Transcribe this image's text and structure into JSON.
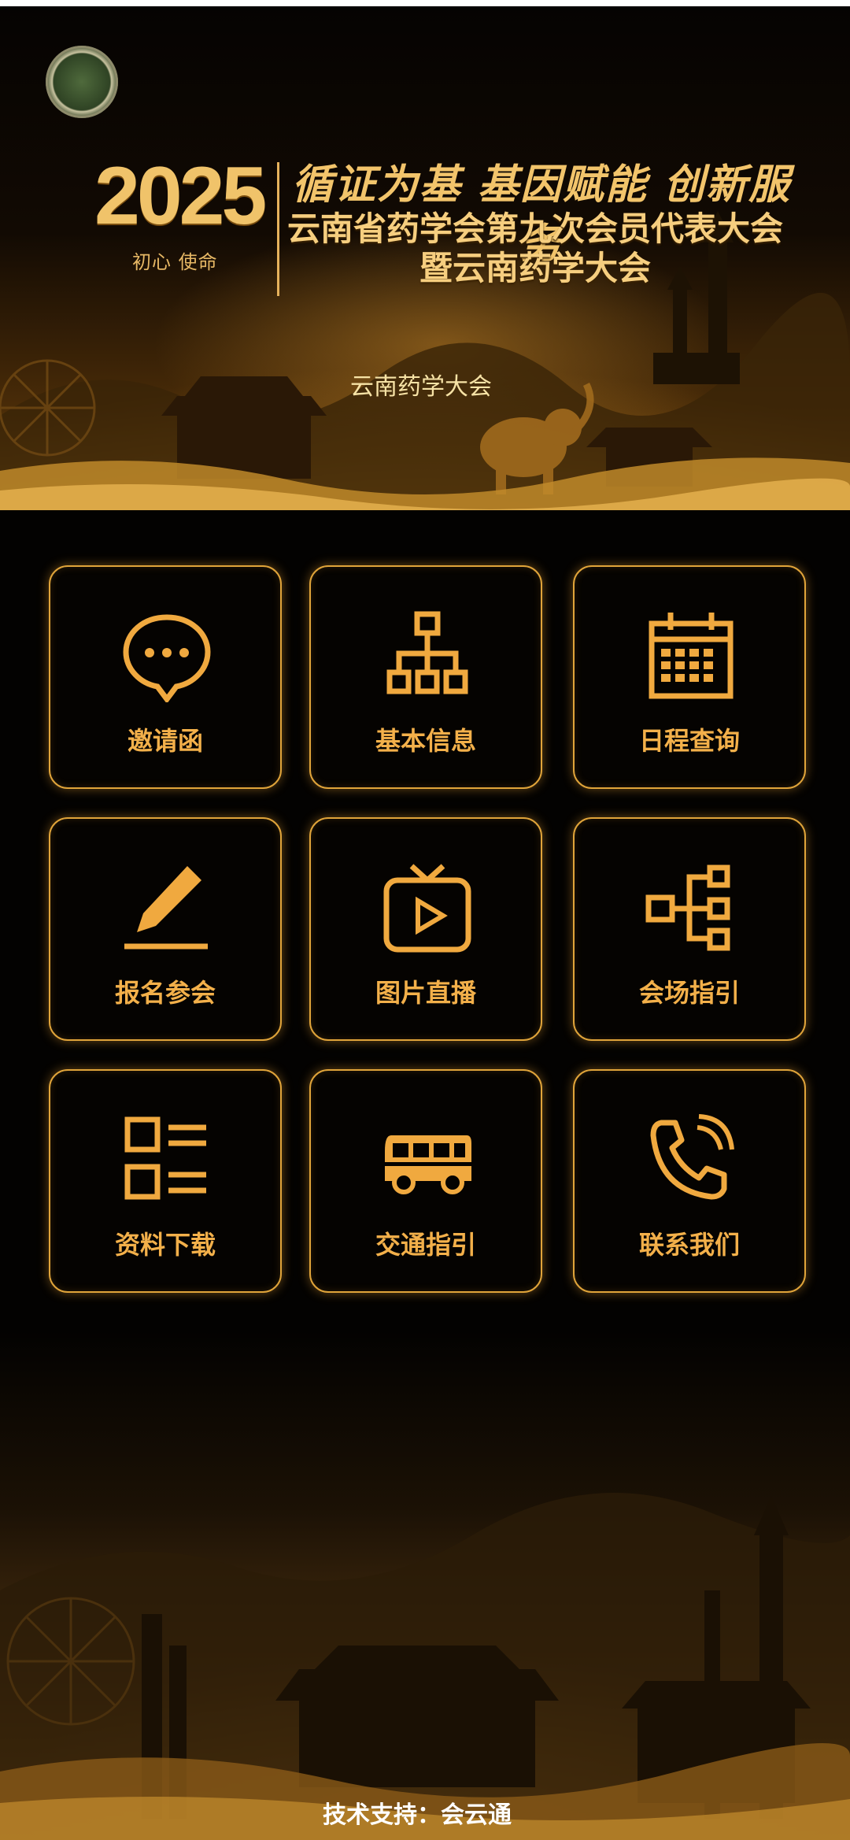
{
  "banner": {
    "year": "2025",
    "year_badge": "初心 使命",
    "slogan": "循证为基 基因赋能 创新服务",
    "conference_title_line1": "云南省药学会第九次会员代表大会",
    "conference_title_line2": "暨云南药学大会",
    "caption": "云南药学大会"
  },
  "menu": [
    {
      "label": "邀请函",
      "icon": "chat-bubble-icon"
    },
    {
      "label": "基本信息",
      "icon": "org-chart-icon"
    },
    {
      "label": "日程查询",
      "icon": "calendar-icon"
    },
    {
      "label": "报名参会",
      "icon": "pencil-icon"
    },
    {
      "label": "图片直播",
      "icon": "tv-play-icon"
    },
    {
      "label": "会场指引",
      "icon": "sitemap-icon"
    },
    {
      "label": "资料下载",
      "icon": "list-icon"
    },
    {
      "label": "交通指引",
      "icon": "bus-icon"
    },
    {
      "label": "联系我们",
      "icon": "phone-icon"
    }
  ],
  "footer": {
    "tech_support": "技术支持：会云通"
  },
  "colors": {
    "accent_gold": "#e0a43a",
    "label_gold": "#f3b04a",
    "background": "#030201"
  }
}
